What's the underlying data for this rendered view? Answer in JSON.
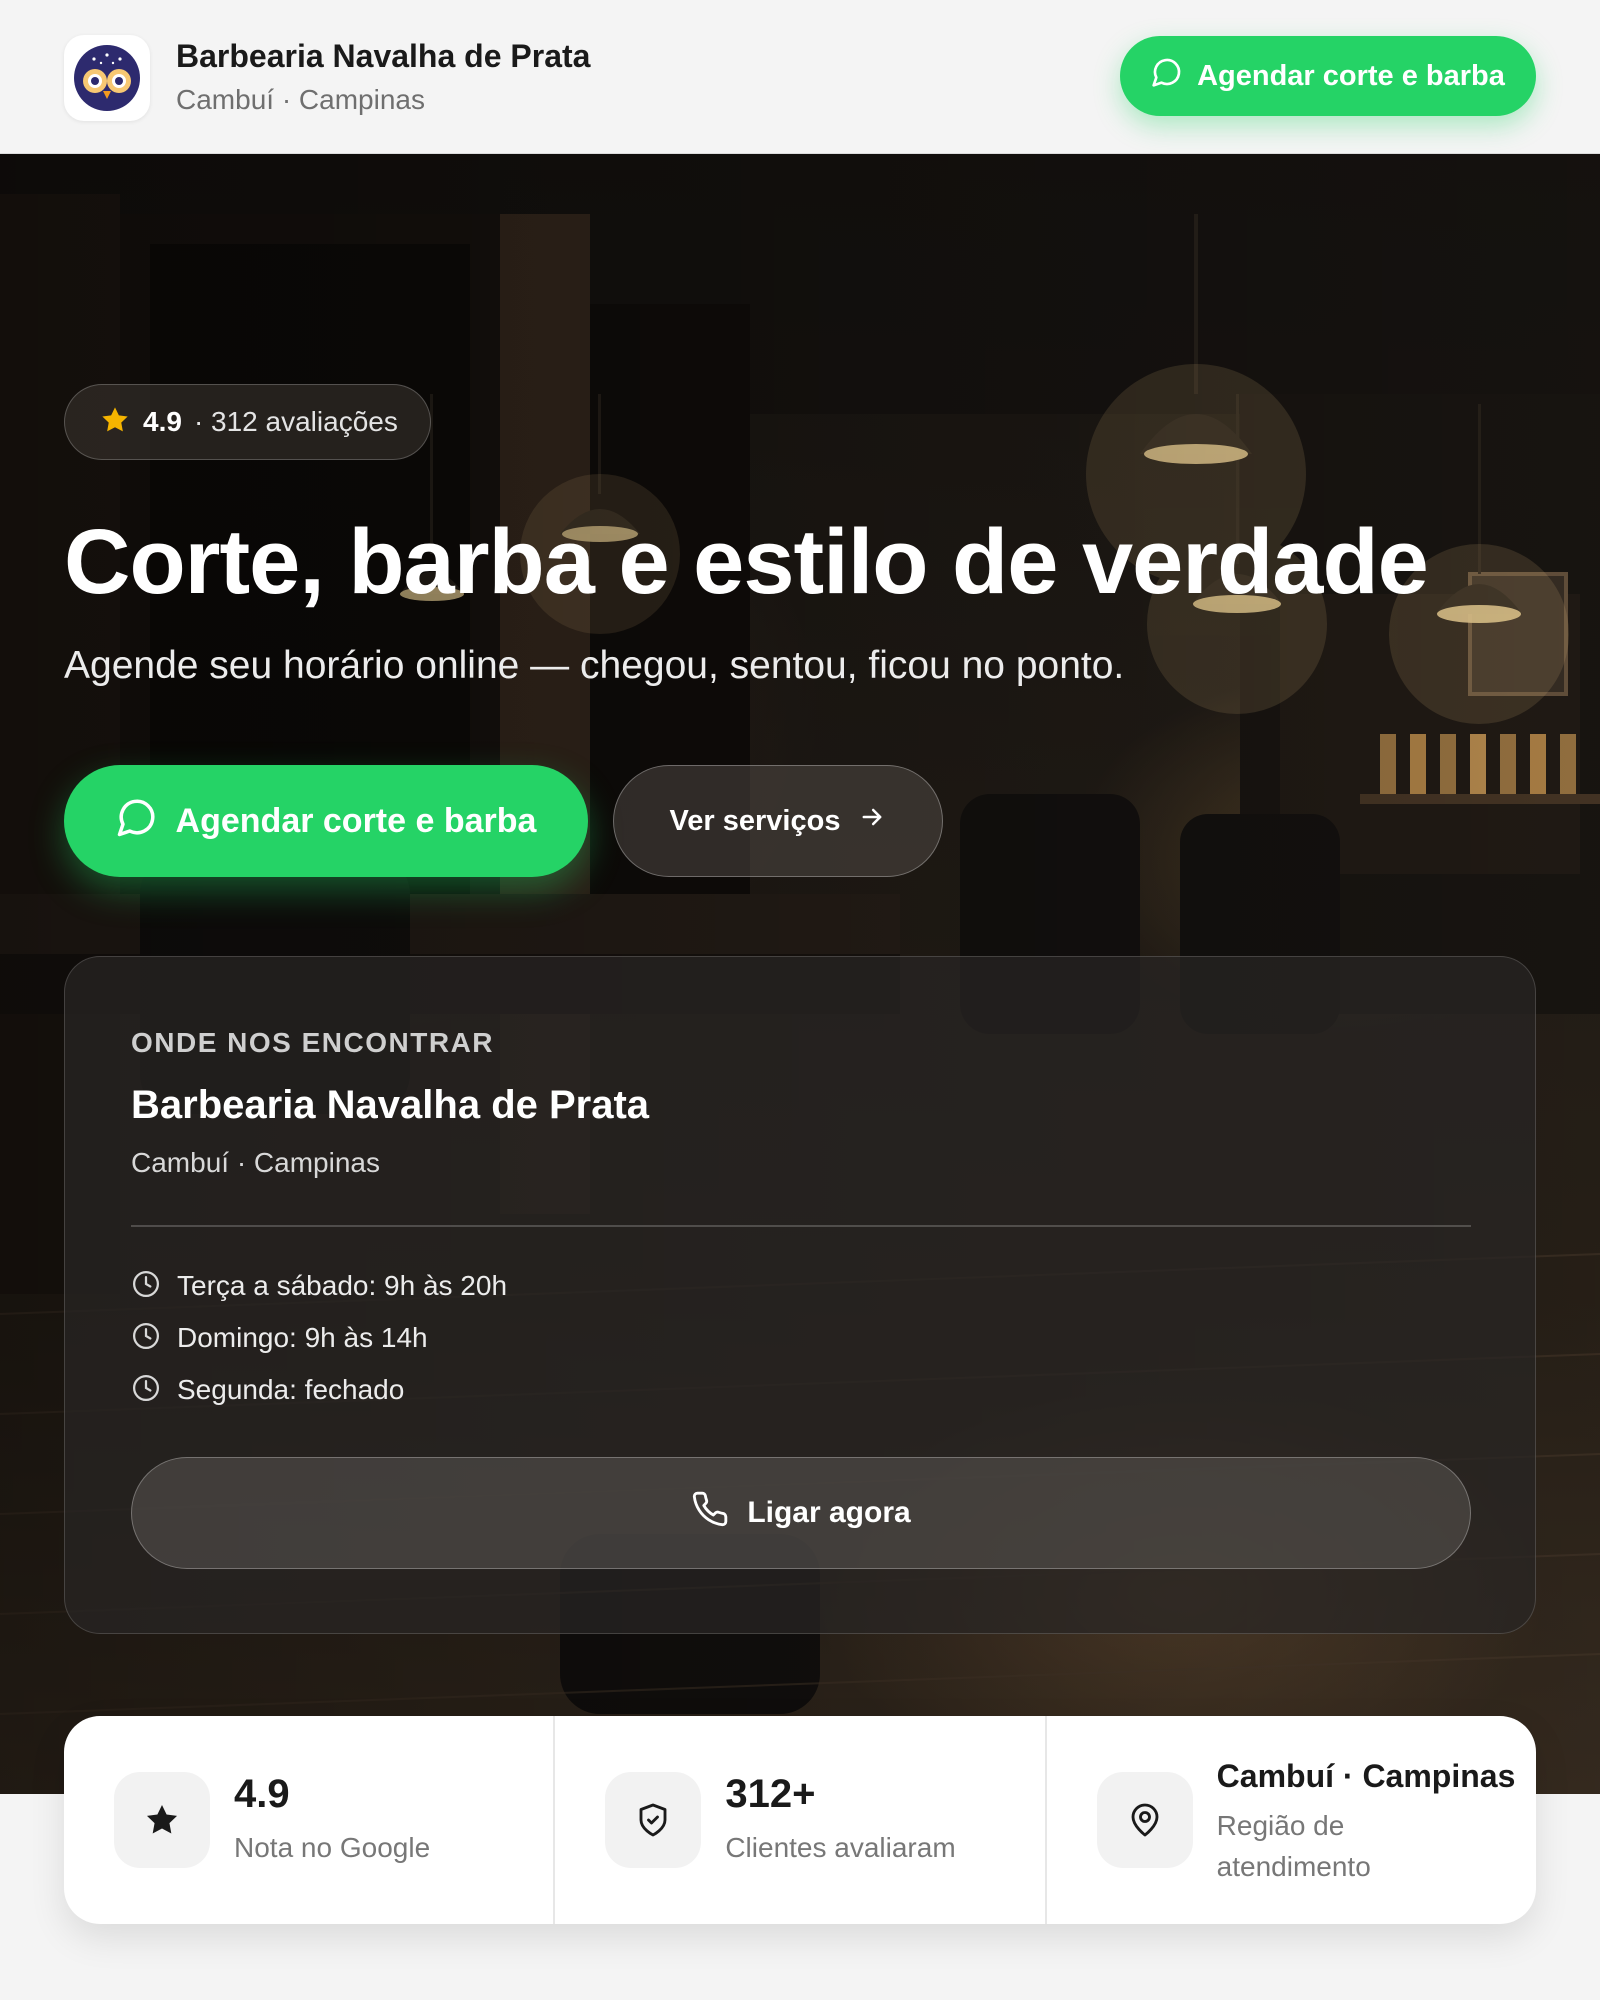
{
  "header": {
    "brand_name": "Barbearia Navalha de Prata",
    "brand_sub": "Cambuí · Campinas",
    "cta_label": "Agendar corte e barba",
    "logo_icon": "owl-icon"
  },
  "hero": {
    "rating_value": "4.9",
    "rating_count": "· 312 avaliações",
    "title": "Corte, barba e estilo de verdade",
    "subtitle": "Agende seu horário online — chegou, sentou, ficou no ponto.",
    "primary_cta": "Agendar corte e barba",
    "secondary_cta": "Ver serviços"
  },
  "location": {
    "eyebrow": "ONDE NOS ENCONTRAR",
    "title": "Barbearia Navalha de Prata",
    "subtitle": "Cambuí · Campinas",
    "hours": [
      "Terça a sábado: 9h às 20h",
      "Domingo: 9h às 14h",
      "Segunda: fechado"
    ],
    "call_label": "Ligar agora"
  },
  "stats": [
    {
      "icon": "star-icon",
      "value": "4.9",
      "label": "Nota no Google"
    },
    {
      "icon": "shield-check-icon",
      "value": "312+",
      "label": "Clientes avaliaram"
    },
    {
      "icon": "map-pin-icon",
      "value": "Cambuí · Campinas",
      "label": "Região de atendimento"
    }
  ],
  "colors": {
    "whatsapp_green": "#25d366",
    "star_yellow": "#f5b400",
    "logo_purple": "#2d2a6e"
  }
}
